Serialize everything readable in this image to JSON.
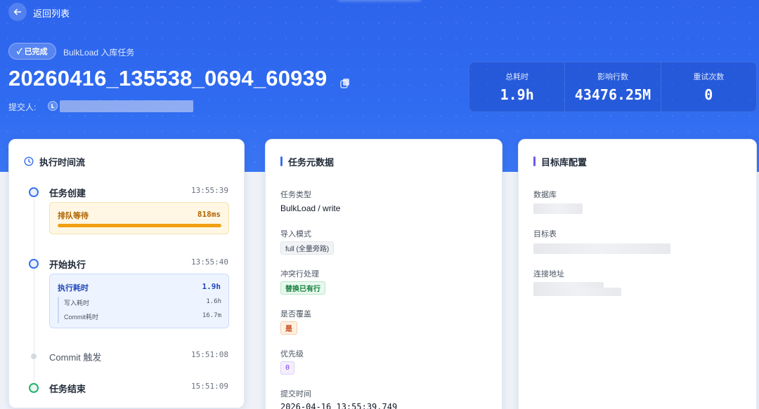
{
  "nav": {
    "back_label": "返回列表"
  },
  "header": {
    "status": "✓ 已完成",
    "task_type": "BulkLoad 入库任务",
    "job_id": "20260416_135538_0694_60939",
    "submitter_label": "提交人:",
    "avatar_initial": "L"
  },
  "stats": [
    {
      "label": "总耗时",
      "value": "1.9h"
    },
    {
      "label": "影响行数",
      "value": "43476.25M"
    },
    {
      "label": "重试次数",
      "value": "0"
    }
  ],
  "timeline": {
    "title": "执行时间流",
    "events": [
      {
        "title": "任务创建",
        "time": "13:55:39"
      },
      {
        "title": "开始执行",
        "time": "13:55:40"
      },
      {
        "title": "Commit 触发",
        "time": "15:51:08"
      },
      {
        "title": "任务结束",
        "time": "15:51:09"
      }
    ],
    "queue": {
      "label": "排队等待",
      "value": "818ms",
      "progress": 1.0
    },
    "exec": {
      "label": "执行耗时",
      "value": "1.9h",
      "sub": [
        {
          "label": "写入耗时",
          "value": "1.6h"
        },
        {
          "label": "Commit耗时",
          "value": "16.7m"
        }
      ]
    }
  },
  "meta": {
    "title": "任务元数据",
    "task_type_label": "任务类型",
    "task_type_value": "BulkLoad / write",
    "import_mode_label": "导入模式",
    "import_mode_value": "full (全量旁路)",
    "conflict_label": "冲突行处理",
    "conflict_value": "替换已有行",
    "overwrite_label": "是否覆盖",
    "overwrite_value": "是",
    "priority_label": "优先级",
    "priority_value": "0",
    "submit_time_label": "提交时间",
    "submit_time_value": "2026-04-16 13:55:39.749"
  },
  "target": {
    "title": "目标库配置",
    "database_label": "数据库",
    "table_label": "目标表",
    "address_label": "连接地址"
  },
  "colors": {
    "brand": "#2f6bf0",
    "queue": "#f0a012",
    "success": "#22b36b",
    "purple": "#6b5ce7"
  }
}
